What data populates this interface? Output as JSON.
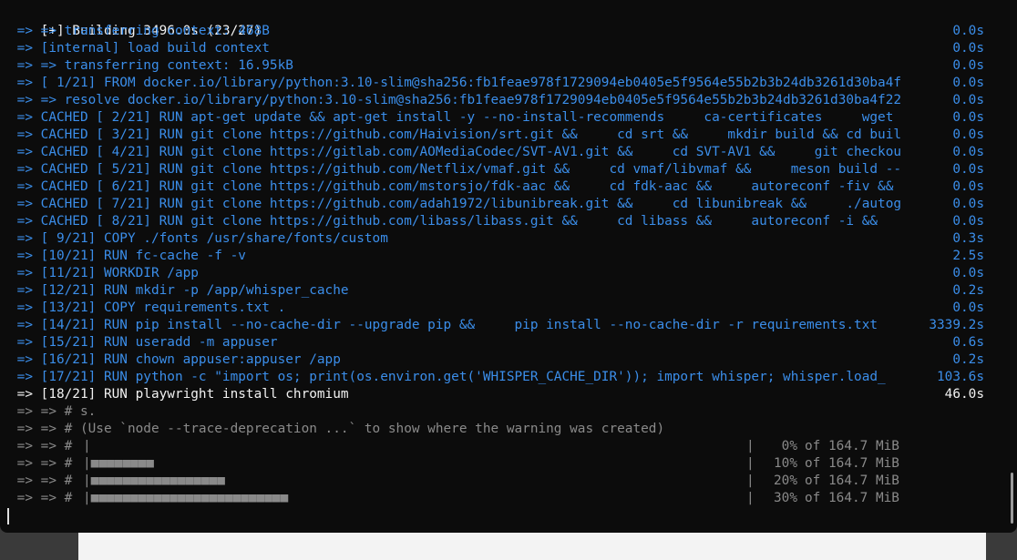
{
  "terminal": {
    "header": "[+] Building 3496.0s (23/27)",
    "steps": [
      {
        "text": " => => transferring context: 468B",
        "time": "0.0s",
        "color": "blue"
      },
      {
        "text": " => [internal] load build context",
        "time": "0.0s",
        "color": "blue"
      },
      {
        "text": " => => transferring context: 16.95kB",
        "time": "0.0s",
        "color": "blue"
      },
      {
        "text": " => [ 1/21] FROM docker.io/library/python:3.10-slim@sha256:fb1feae978f1729094eb0405e5f9564e55b2b3b24db3261d30ba4f",
        "time": "0.0s",
        "color": "blue"
      },
      {
        "text": " => => resolve docker.io/library/python:3.10-slim@sha256:fb1feae978f1729094eb0405e5f9564e55b2b3b24db3261d30ba4f22",
        "time": "0.0s",
        "color": "blue"
      },
      {
        "text": " => CACHED [ 2/21] RUN apt-get update && apt-get install -y --no-install-recommends     ca-certificates     wget",
        "time": "0.0s",
        "color": "blue"
      },
      {
        "text": " => CACHED [ 3/21] RUN git clone https://github.com/Haivision/srt.git &&     cd srt &&     mkdir build && cd buil",
        "time": "0.0s",
        "color": "blue"
      },
      {
        "text": " => CACHED [ 4/21] RUN git clone https://gitlab.com/AOMediaCodec/SVT-AV1.git &&     cd SVT-AV1 &&     git checkou",
        "time": "0.0s",
        "color": "blue"
      },
      {
        "text": " => CACHED [ 5/21] RUN git clone https://github.com/Netflix/vmaf.git &&     cd vmaf/libvmaf &&     meson build --",
        "time": "0.0s",
        "color": "blue"
      },
      {
        "text": " => CACHED [ 6/21] RUN git clone https://github.com/mstorsjo/fdk-aac &&     cd fdk-aac &&     autoreconf -fiv &&",
        "time": "0.0s",
        "color": "blue"
      },
      {
        "text": " => CACHED [ 7/21] RUN git clone https://github.com/adah1972/libunibreak.git &&     cd libunibreak &&     ./autog",
        "time": "0.0s",
        "color": "blue"
      },
      {
        "text": " => CACHED [ 8/21] RUN git clone https://github.com/libass/libass.git &&     cd libass &&     autoreconf -i &&",
        "time": "0.0s",
        "color": "blue"
      },
      {
        "text": " => [ 9/21] COPY ./fonts /usr/share/fonts/custom",
        "time": "0.3s",
        "color": "blue"
      },
      {
        "text": " => [10/21] RUN fc-cache -f -v",
        "time": "2.5s",
        "color": "blue"
      },
      {
        "text": " => [11/21] WORKDIR /app",
        "time": "0.0s",
        "color": "blue"
      },
      {
        "text": " => [12/21] RUN mkdir -p /app/whisper_cache",
        "time": "0.2s",
        "color": "blue"
      },
      {
        "text": " => [13/21] COPY requirements.txt .",
        "time": "0.0s",
        "color": "blue"
      },
      {
        "text": " => [14/21] RUN pip install --no-cache-dir --upgrade pip &&     pip install --no-cache-dir -r requirements.txt",
        "time": "3339.2s",
        "color": "blue"
      },
      {
        "text": " => [15/21] RUN useradd -m appuser",
        "time": "0.6s",
        "color": "blue"
      },
      {
        "text": " => [16/21] RUN chown appuser:appuser /app",
        "time": "0.2s",
        "color": "blue"
      },
      {
        "text": " => [17/21] RUN python -c \"import os; print(os.environ.get('WHISPER_CACHE_DIR')); import whisper; whisper.load_",
        "time": "103.6s",
        "color": "blue"
      },
      {
        "text": " => [18/21] RUN playwright install chromium",
        "time": "46.0s",
        "color": "white"
      },
      {
        "text": " => => # s.",
        "time": "",
        "color": "gray"
      },
      {
        "text": " => => # (Use `node --trace-deprecation ...` to show where the warning was created)",
        "time": "",
        "color": "gray"
      }
    ],
    "progress": [
      {
        "prefix": " => => #",
        "bar": "|",
        "sep": "|",
        "pct": "0%",
        "size": "of 164.7 MiB",
        "fill": 0.0
      },
      {
        "prefix": " => => #",
        "bar": "|■■■■■■■■",
        "sep": "|",
        "pct": "10%",
        "size": "of 164.7 MiB",
        "fill": 0.1
      },
      {
        "prefix": " => => #",
        "bar": "|■■■■■■■■■■■■■■■■■",
        "sep": "|",
        "pct": "20%",
        "size": "of 164.7 MiB",
        "fill": 0.2
      },
      {
        "prefix": " => => #",
        "bar": "|■■■■■■■■■■■■■■■■■■■■■■■■■",
        "sep": "|",
        "pct": "30%",
        "size": "of 164.7 MiB",
        "fill": 0.3
      }
    ]
  }
}
